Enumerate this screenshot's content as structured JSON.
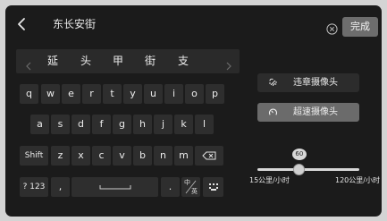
{
  "search": {
    "query": "东长安街",
    "done_label": "完成"
  },
  "candidates": [
    "延",
    "头",
    "甲",
    "街",
    "支"
  ],
  "keyboard": {
    "row1": [
      "q",
      "w",
      "e",
      "r",
      "t",
      "y",
      "u",
      "i",
      "o",
      "p"
    ],
    "row2": [
      "a",
      "s",
      "d",
      "f",
      "g",
      "h",
      "j",
      "k",
      "l"
    ],
    "shift_label": "Shift",
    "row3": [
      "z",
      "x",
      "c",
      "v",
      "b",
      "n",
      "m"
    ],
    "numeric_label": "? 123",
    "comma_label": ",",
    "period_label": ".",
    "lang_top": "中",
    "lang_bottom": "英"
  },
  "panel": {
    "violation_label": "违章摄像头",
    "speed_label": "超速摄像头",
    "speed_selected": true
  },
  "slider": {
    "value_label": "60",
    "value": 60,
    "min_label": "15公里/小时",
    "max_label": "120公里/小时",
    "fraction": 0.4
  },
  "colors": {
    "background": "#1b1b1b",
    "key": "#2e2e2e",
    "selected_button": "#6b6b6b",
    "text": "#ececec"
  },
  "icons": {
    "back": "chevron-left-icon",
    "clear": "clear-circle-icon",
    "candidate_prev": "chevron-left-icon",
    "candidate_next": "chevron-right-icon",
    "backspace": "backspace-icon",
    "space": "space-bar-icon",
    "keyboard_switch": "keyboard-icon",
    "violation": "violation-camera-icon",
    "speed": "speed-camera-icon"
  }
}
